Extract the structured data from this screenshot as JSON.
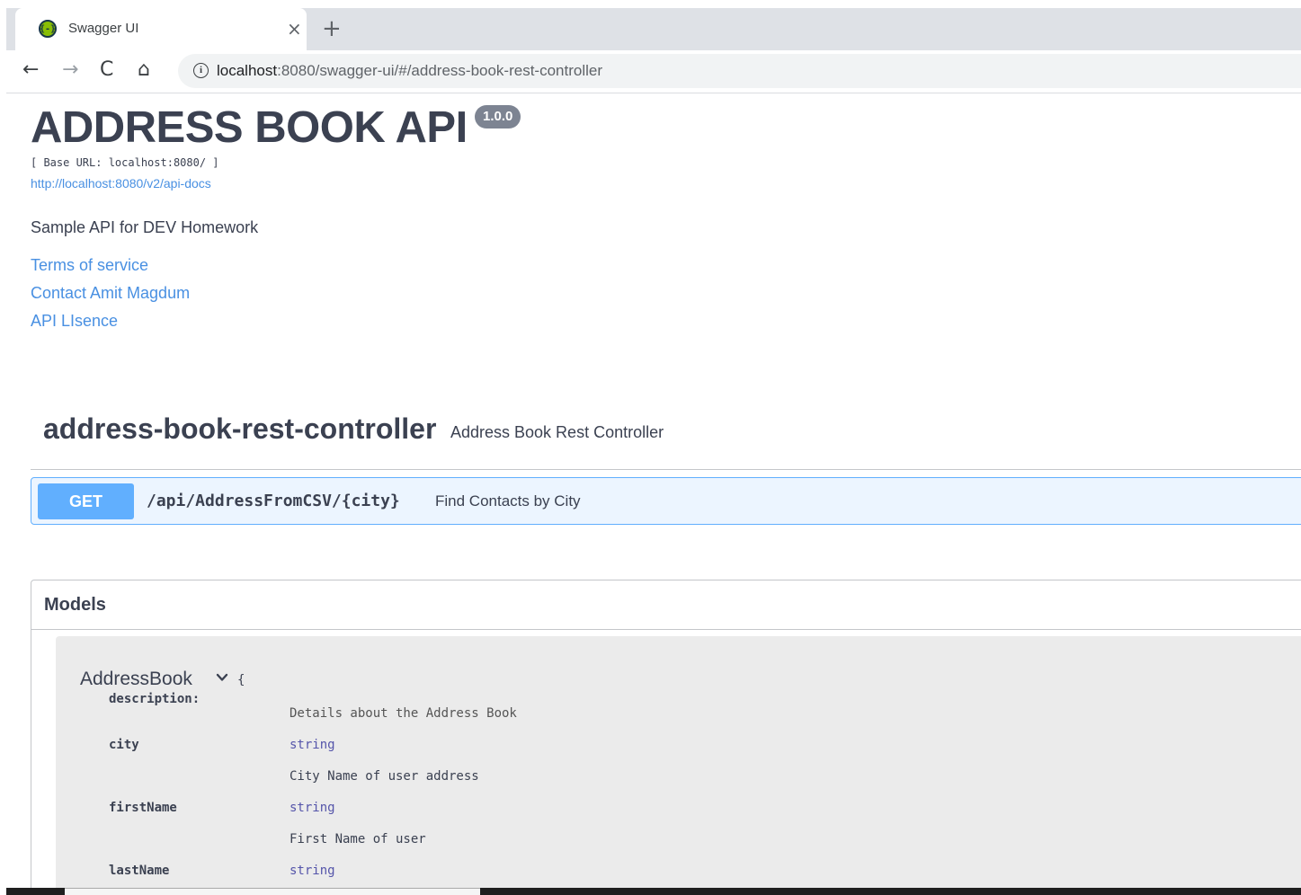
{
  "browser": {
    "tab": {
      "title": "Swagger UI",
      "favicon": "{-}",
      "close_label": "×"
    },
    "new_tab_label": "+",
    "nav": {
      "back": "←",
      "forward": "→",
      "reload": "C",
      "home": "⌂"
    },
    "info_icon": "i",
    "url": {
      "host": "localhost",
      "rest": ":8080/swagger-ui/#/address-book-rest-controller"
    }
  },
  "info": {
    "title": "ADDRESS BOOK API",
    "version": "1.0.0",
    "base_url": "[ Base URL: localhost:8080/ ]",
    "api_docs_link": "http://localhost:8080/v2/api-docs",
    "description": "Sample API for DEV Homework",
    "links": {
      "terms": "Terms of service",
      "contact": "Contact Amit Magdum",
      "license": "API LIsence"
    }
  },
  "tag": {
    "name": "address-book-rest-controller",
    "description": "Address Book Rest Controller"
  },
  "operation": {
    "method": "GET",
    "path": "/api/AddressFromCSV/{city}",
    "summary": "Find Contacts by City"
  },
  "models": {
    "title": "Models",
    "model": {
      "name": "AddressBook",
      "brace": "{",
      "description_label": "description:",
      "description": "Details about the Address Book",
      "properties": [
        {
          "name": "city",
          "type": "string",
          "description": "City Name of user address"
        },
        {
          "name": "firstName",
          "type": "string",
          "description": "First Name of user"
        },
        {
          "name": "lastName",
          "type": "string"
        }
      ]
    }
  },
  "colors": {
    "get_method": "#61affe",
    "link": "#4990e2",
    "text": "#3b4151",
    "version_badge": "#7d8492"
  }
}
